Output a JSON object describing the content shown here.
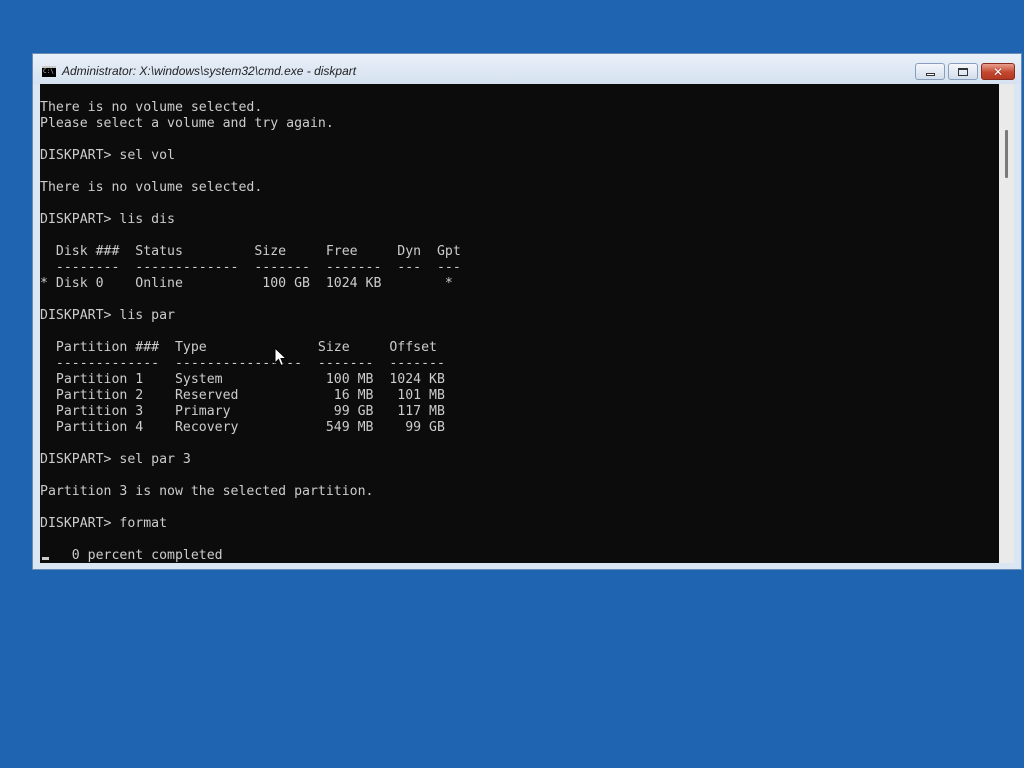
{
  "window": {
    "title": "Administrator: X:\\windows\\system32\\cmd.exe - diskpart",
    "icon_label": "C:\\",
    "minimize_icon": "minimize-icon",
    "maximize_icon": "restore-icon",
    "close_icon": "close-icon",
    "close_glyph": "✕"
  },
  "console": {
    "lines": [
      "There is no volume selected.",
      "Please select a volume and try again.",
      "",
      "DISKPART> sel vol",
      "",
      "There is no volume selected.",
      "",
      "DISKPART> lis dis",
      "",
      "  Disk ###  Status         Size     Free     Dyn  Gpt",
      "  --------  -------------  -------  -------  ---  ---",
      "* Disk 0    Online          100 GB  1024 KB        *",
      "",
      "DISKPART> lis par",
      "",
      "  Partition ###  Type              Size     Offset",
      "  -------------  ----------------  -------  -------",
      "  Partition 1    System             100 MB  1024 KB",
      "  Partition 2    Reserved            16 MB   101 MB",
      "  Partition 3    Primary             99 GB   117 MB",
      "  Partition 4    Recovery           549 MB    99 GB",
      "",
      "DISKPART> sel par 3",
      "",
      "Partition 3 is now the selected partition.",
      "",
      "DISKPART> format",
      "",
      "    0 percent completed"
    ]
  },
  "colors": {
    "desktop": "#1f64b0",
    "console_bg": "#0c0c0c",
    "console_fg": "#cccccc"
  }
}
